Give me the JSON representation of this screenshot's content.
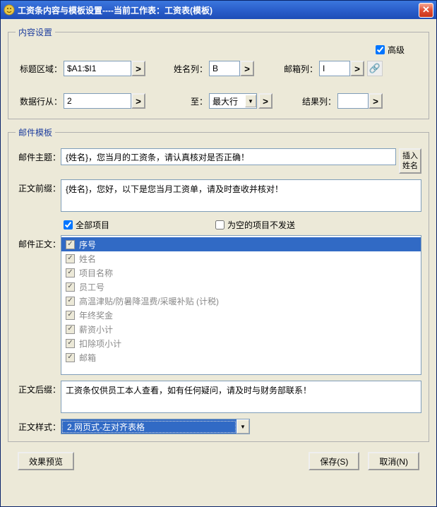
{
  "window": {
    "title": "工资条内容与模板设置----当前工作表：工资表(模板)"
  },
  "content_settings": {
    "legend": "内容设置",
    "advanced": "高级",
    "title_area_label": "标题区域：",
    "title_area_value": "$A1:$I1",
    "name_col_label": "姓名列：",
    "name_col_value": "B",
    "email_col_label": "邮箱列：",
    "email_col_value": "I",
    "data_row_from_label": "数据行从：",
    "data_row_from_value": "2",
    "to_label": "至：",
    "to_value": "最大行",
    "result_col_label": "结果列：",
    "result_col_value": ""
  },
  "mail_template": {
    "legend": "邮件模板",
    "subject_label": "邮件主题：",
    "subject_value": "{姓名}，您当月的工资条，请认真核对是否正确！",
    "insert_name": "插入姓名",
    "prefix_label": "正文前缀：",
    "prefix_value": "{姓名}，您好，以下是您当月工资单，请及时查收并核对！",
    "all_items": "全部项目",
    "skip_empty": "为空的项目不发送",
    "body_label": "邮件正文：",
    "items": [
      "序号",
      "姓名",
      "项目名称",
      "员工号",
      "高温津贴/防暑降温费/采暖补贴 (计税)",
      "年终奖金",
      "薪资小计",
      "扣除项小计",
      "邮箱"
    ],
    "suffix_label": "正文后缀：",
    "suffix_value": "工资条仅供员工本人查看，如有任何疑问，请及时与财务部联系！",
    "style_label": "正文样式：",
    "style_value": "2.网页式-左对齐表格"
  },
  "buttons": {
    "preview": "效果预览",
    "save": "保存(S)",
    "cancel": "取消(N)"
  }
}
